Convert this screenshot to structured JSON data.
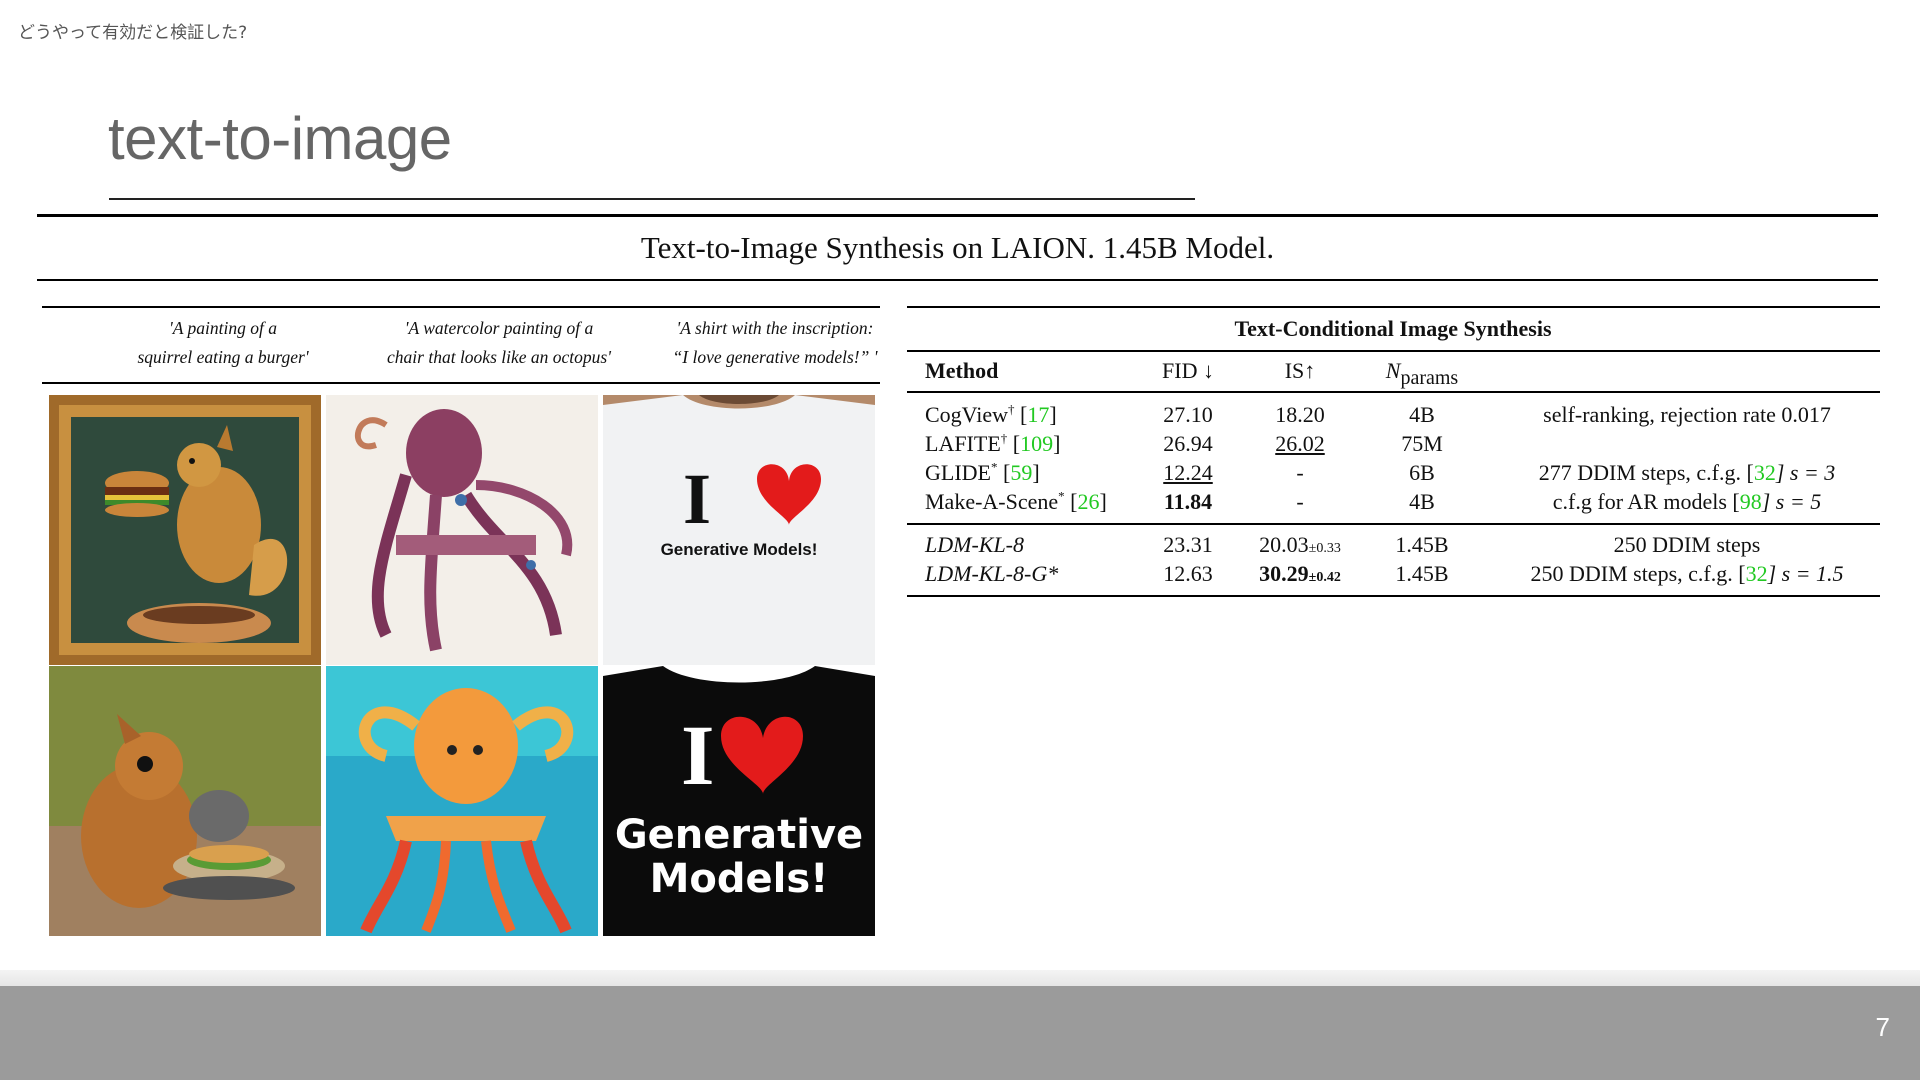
{
  "header": {
    "breadcrumb": "どうやって有効だと検証した?",
    "title": "text-to-image"
  },
  "figure": {
    "caption": "Text-to-Image Synthesis on LAION. 1.45B Model.",
    "prompts": [
      {
        "line1": "'A painting of a",
        "line2": "squirrel eating a burger'"
      },
      {
        "line1": "'A watercolor painting of a",
        "line2": "chair that looks like an octopus'"
      },
      {
        "line1": "'A shirt with the inscription:",
        "line2": "“I love generative models!” '"
      }
    ],
    "images": {
      "shirt_top_i": "I",
      "shirt_top_text": "Generative Models!",
      "shirt_bottom_i": "I",
      "shirt_bottom_line1": "Generative",
      "shirt_bottom_line2": "Models!"
    }
  },
  "table": {
    "title": "Text-Conditional Image Synthesis",
    "headers": {
      "method": "Method",
      "fid": "FID ↓",
      "is": "IS↑",
      "n": "N",
      "n_sub": "params"
    },
    "rows": [
      {
        "method": "CogView",
        "mark": "†",
        "ref": "17",
        "fid": "27.10",
        "is": "18.20",
        "params": "4B",
        "note_pre": "self-ranking, rejection rate 0.017",
        "note_ref": "",
        "note_post": ""
      },
      {
        "method": "LAFITE",
        "mark": "†",
        "ref": "109",
        "fid": "26.94",
        "is": "26.02",
        "params": "75M",
        "note_pre": "",
        "note_ref": "",
        "note_post": ""
      },
      {
        "method": "GLIDE",
        "mark": "*",
        "ref": "59",
        "fid": "12.24",
        "is": "-",
        "params": "6B",
        "note_pre": "277 DDIM steps, c.f.g. [",
        "note_ref": "32",
        "note_post": "] s = 3"
      },
      {
        "method": "Make-A-Scene",
        "mark": "*",
        "ref": "26",
        "fid": "11.84",
        "is": "-",
        "params": "4B",
        "note_pre": "c.f.g for AR models [",
        "note_ref": "98",
        "note_post": "] s = 5"
      },
      {
        "method": "LDM-KL-8",
        "fid": "23.31",
        "is": "20.03",
        "is_pm": "±0.33",
        "params": "1.45B",
        "note_pre": "250 DDIM steps",
        "note_ref": "",
        "note_post": ""
      },
      {
        "method": "LDM-KL-8-G*",
        "fid": "12.63",
        "is": "30.29",
        "is_pm": "±0.42",
        "params": "1.45B",
        "note_pre": "250 DDIM steps, c.f.g. [",
        "note_ref": "32",
        "note_post": "] s = 1.5"
      }
    ]
  },
  "footer": {
    "page_number": "7"
  }
}
